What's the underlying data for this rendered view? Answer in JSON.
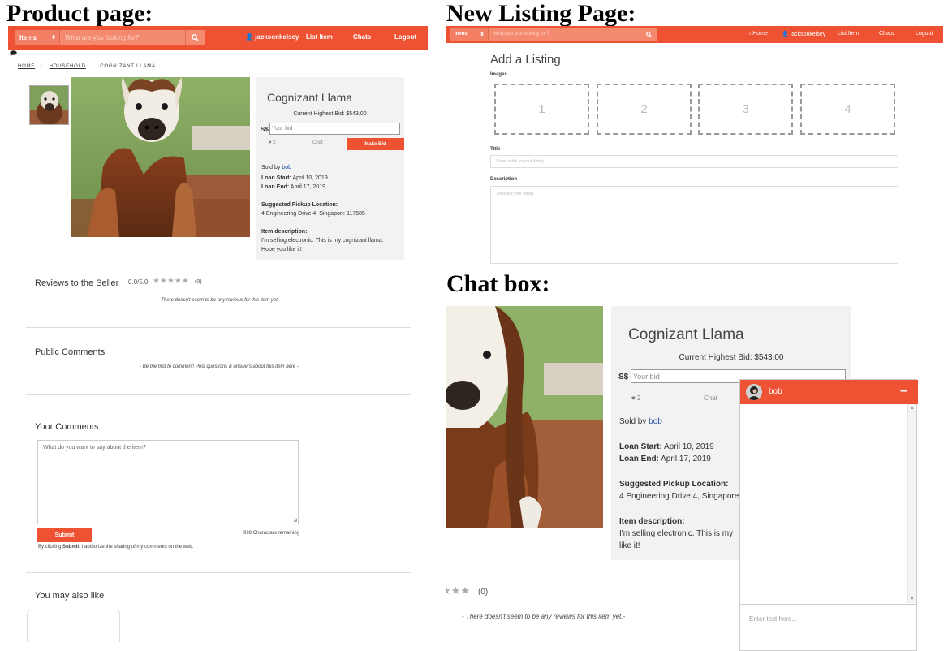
{
  "headings": {
    "product": "Product page:",
    "new_listing": "New Listing Page:",
    "chat_box": "Chat box:"
  },
  "product_page": {
    "nav": {
      "category": "Items",
      "search_placeholder": "What are you looking for?",
      "username": "jacksonkelsey",
      "list_item": "List Item",
      "chats": "Chats",
      "logout": "Logout"
    },
    "breadcrumb": {
      "home": "HOME",
      "household": "HOUSEHOLD",
      "current": "COGNIZANT LLAMA",
      "sep": "/"
    },
    "item": {
      "title": "Cognizant Llama",
      "current_bid": "Current Highest Bid: $543.00",
      "currency": "S$",
      "bid_placeholder": "Your bid",
      "likes": "2",
      "chat": "Chat",
      "make_bid": "Make Bid",
      "sold_by_label": "Sold by",
      "seller": "bob",
      "loan_start_label": "Loan Start:",
      "loan_start": "April 10, 2019",
      "loan_end_label": "Loan End:",
      "loan_end": "April 17, 2019",
      "pickup_label": "Suggested Pickup Location:",
      "pickup": "4 Engineering Drive 4, Singapore 117585",
      "desc_label": "Item description:",
      "desc_line1": "I'm selling electronic. This is my cognizant llama.",
      "desc_line2": "Hope you like it!"
    },
    "reviews": {
      "title": "Reviews to the Seller",
      "score": "0.0/5.0",
      "count": "(0)",
      "empty": "- There doesn't seem to be any reviews for this item yet.-"
    },
    "public_comments": {
      "title": "Public Comments",
      "empty": "- Be the first to comment! Post questions & answers about this item here -"
    },
    "your_comments": {
      "title": "Your Comments",
      "placeholder": "What do you want to say about the item?",
      "submit": "Submit",
      "remaining": "999 Characters remaining",
      "consent_pre": "By clicking ",
      "consent_bold": "Submit",
      "consent_post": ", I authorize the sharing of my comments on the web."
    },
    "also_like": {
      "title": "You may also like"
    }
  },
  "new_listing_page": {
    "nav": {
      "category": "Items",
      "search_placeholder": "What are you looking for?",
      "home": "Home",
      "username": "jacksonkelsey",
      "list_item": "List Item",
      "chats": "Chats",
      "logout": "Logout"
    },
    "title": "Add a Listing",
    "images_label": "Images",
    "image_slots": [
      "1",
      "2",
      "3",
      "4"
    ],
    "title_label": "Title",
    "title_placeholder": "Enter a title for your listing",
    "description_label": "Description",
    "description_placeholder": "Describe your listing"
  },
  "chat_view": {
    "item_title": "Cognizant Llama",
    "current_bid": "Current Highest Bid: $543.00",
    "currency": "S$",
    "bid_placeholder": "Your bid",
    "likes": "2",
    "chat": "Chat",
    "sold_by_label": "Sold by",
    "seller": "bob",
    "loan_start_label": "Loan Start:",
    "loan_start": "April 10, 2019",
    "loan_end_label": "Loan End:",
    "loan_end": "April 17, 2019",
    "pickup_label": "Suggested Pickup Location:",
    "pickup": "4 Engineering Drive 4, Singapore",
    "desc_label": "Item description:",
    "desc_line1": "I'm selling electronic. This is my",
    "desc_line2": "like it!",
    "reviews_count": "(0)",
    "reviews_empty": "- There doesn't seem to be any reviews for this item yet.-",
    "chat_box": {
      "name": "bob",
      "minimize": "–",
      "input_placeholder": "Enter text here..."
    }
  },
  "colors": {
    "brand": "#ee5232",
    "panel": "#f2f2f2",
    "link": "#1a4fa0"
  },
  "icons": [
    "search-icon",
    "user-icon",
    "home-icon",
    "heart-icon",
    "chat-bubble-icon",
    "star-icon",
    "minimize-icon",
    "scroll-arrow-icon"
  ]
}
